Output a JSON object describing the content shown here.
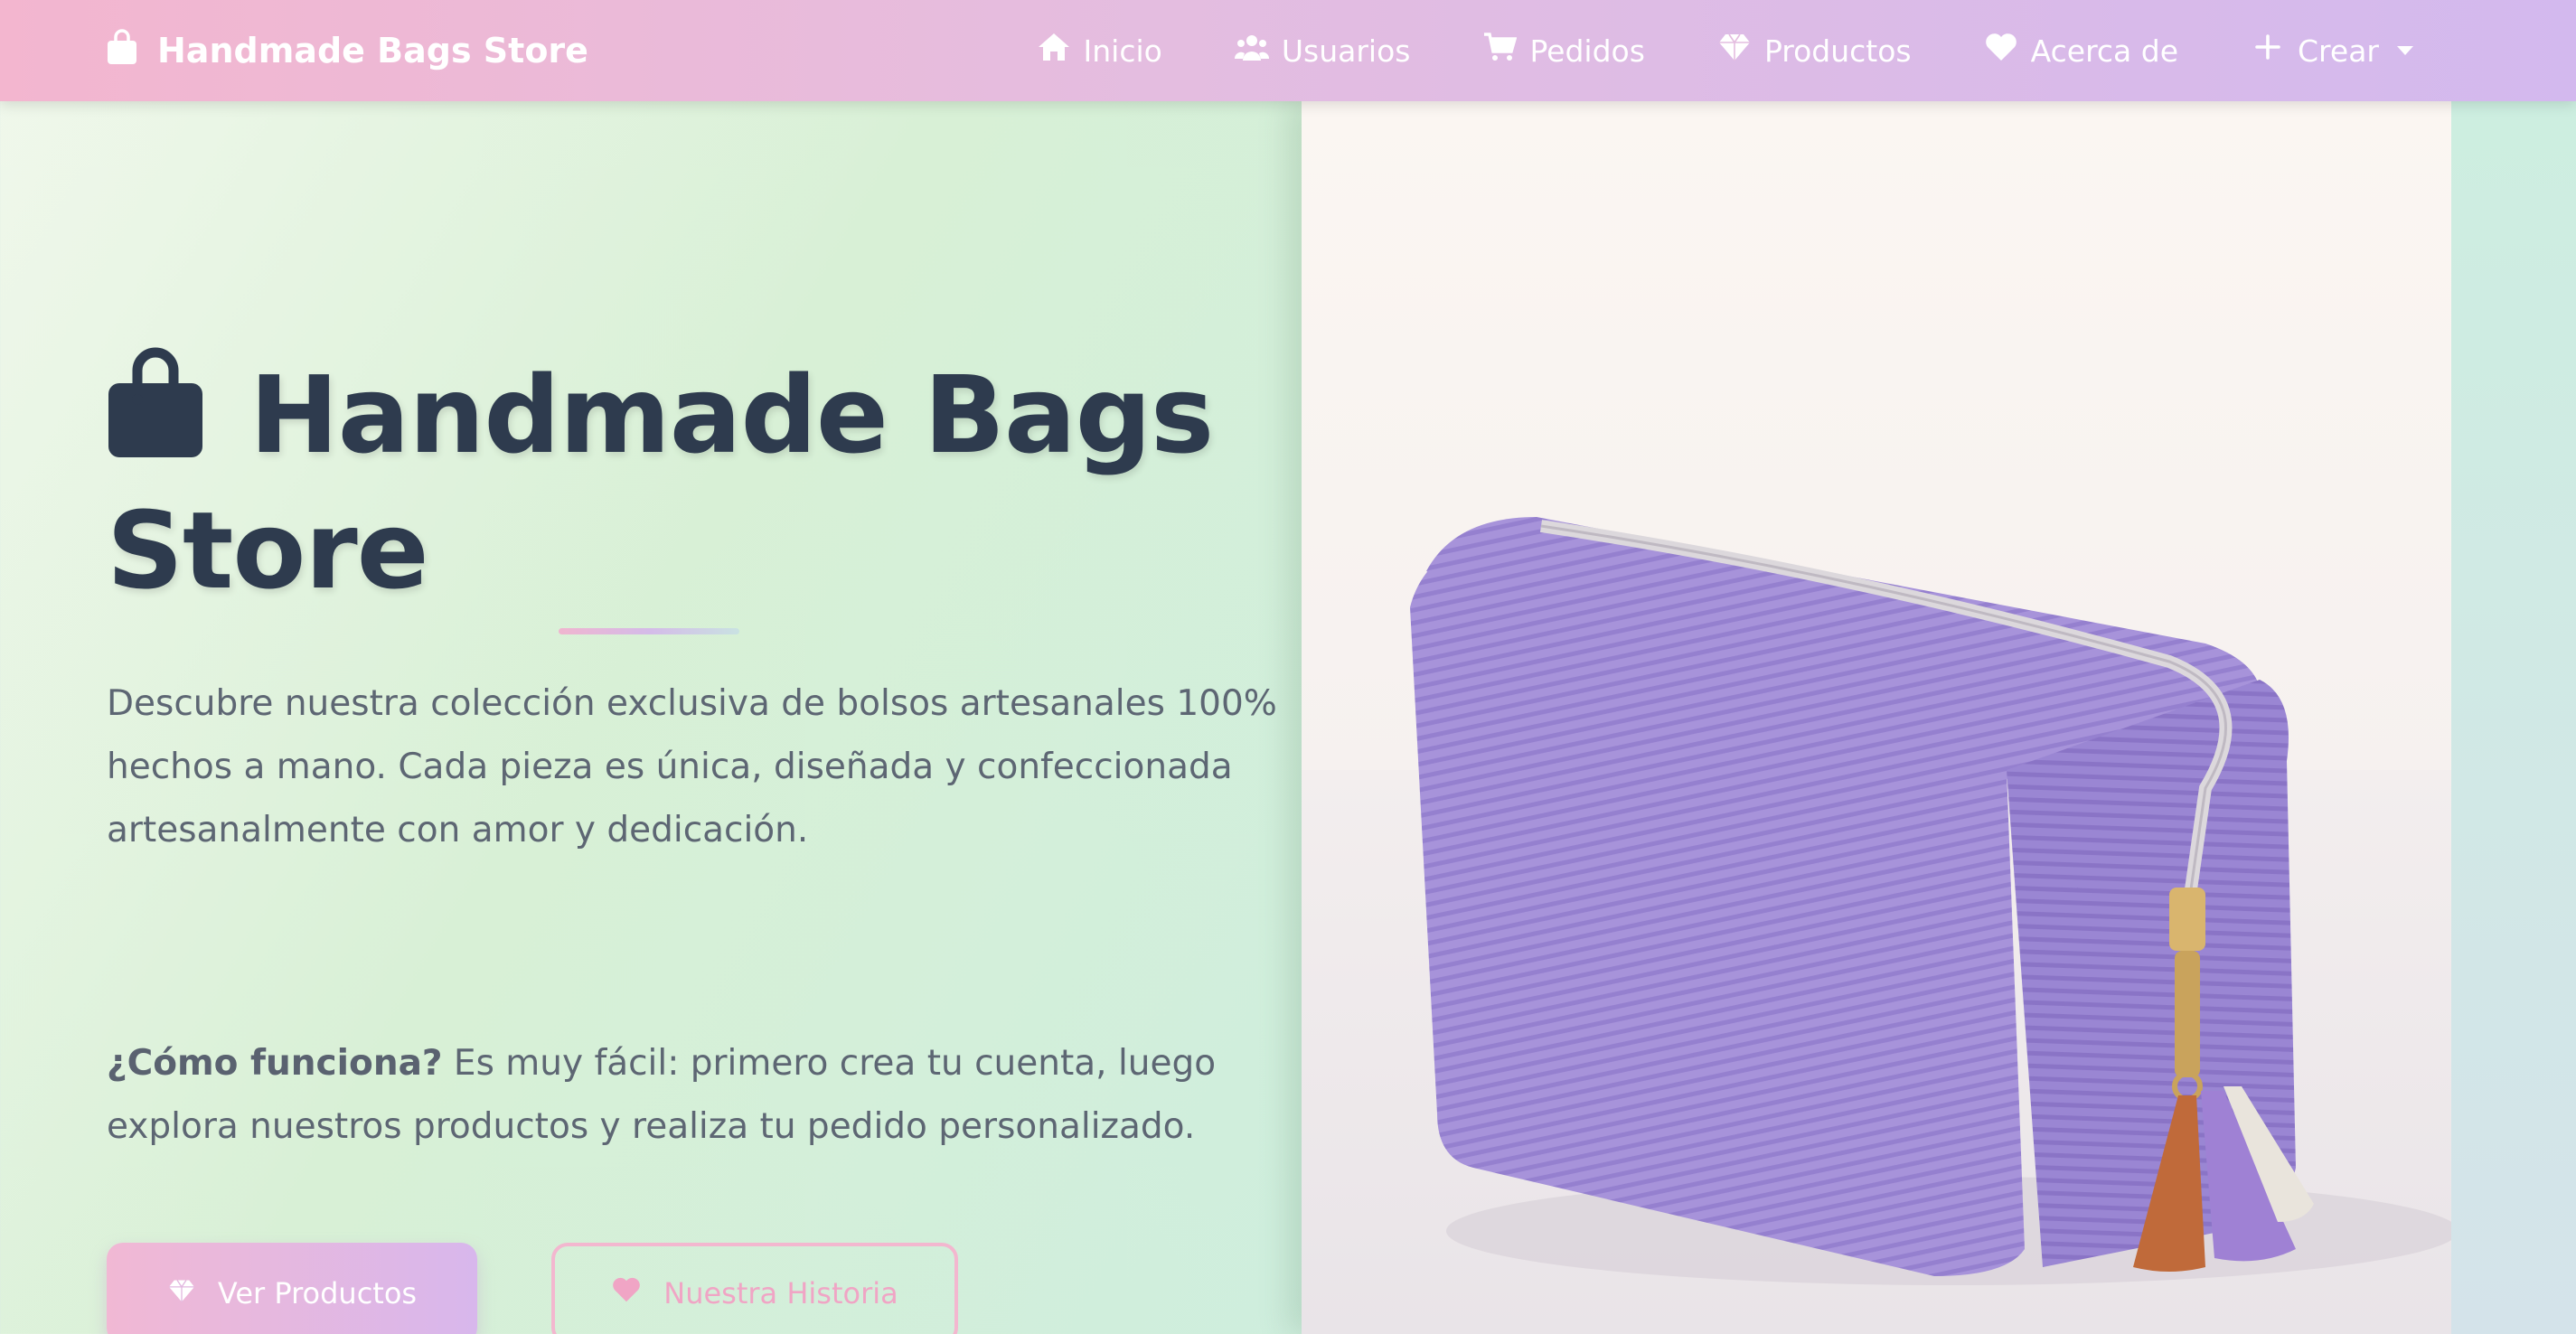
{
  "navbar": {
    "brand": "Handmade Bags Store",
    "brand_icon": "shopping-bag-icon",
    "links": [
      {
        "label": "Inicio",
        "icon": "home-icon"
      },
      {
        "label": "Usuarios",
        "icon": "users-icon"
      },
      {
        "label": "Pedidos",
        "icon": "shopping-cart-icon"
      },
      {
        "label": "Productos",
        "icon": "gem-icon"
      },
      {
        "label": "Acerca de",
        "icon": "heart-icon"
      },
      {
        "label": "Crear",
        "icon": "plus-icon"
      }
    ]
  },
  "hero": {
    "title": "Handmade Bags Store",
    "description": "Descubre nuestra colección exclusiva de bolsos artesanales 100% hechos a mano. Cada pieza es única, diseñada y confeccionada artesanalmente con amor y dedicación.",
    "how_label": "¿Cómo funciona?",
    "how_text": " Es muy fácil: primero crea tu cuenta, luego explora nuestros productos y realiza tu pedido personalizado.",
    "primary_button": "Ver Productos",
    "secondary_button": "Nuestra Historia"
  },
  "colors": {
    "navbar_start": "#f3b6cf",
    "navbar_end": "#d3b9ee",
    "title": "#2e3b4e",
    "text": "#5d6673",
    "accent_pink": "#f0a5c5",
    "bag_lilac": "#a48fd8"
  }
}
